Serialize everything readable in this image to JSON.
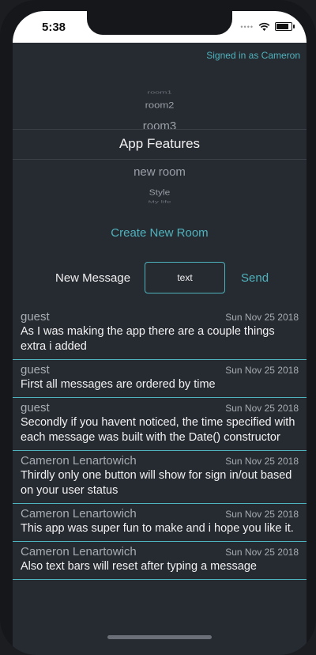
{
  "status_bar": {
    "time": "5:38",
    "wifi_icon": "wifi-icon",
    "battery_icon": "battery-icon"
  },
  "header": {
    "signed_in_text": "Signed in as Cameron"
  },
  "picker": {
    "rows": [
      "room1",
      "room2",
      "room3",
      "App Features",
      "new room",
      "Style",
      "My life"
    ],
    "selected": "App Features"
  },
  "create_room_label": "Create New Room",
  "composer": {
    "label": "New Message",
    "input_value": "text",
    "send_label": "Send"
  },
  "messages": [
    {
      "user": "guest",
      "date": "Sun Nov 25 2018",
      "text": "As I was making the app there are a couple things extra i added"
    },
    {
      "user": "guest",
      "date": "Sun Nov 25 2018",
      "text": "First all messages are ordered by time"
    },
    {
      "user": "guest",
      "date": "Sun Nov 25 2018",
      "text": "Secondly if you havent noticed, the time specified with each message was built with the Date() constructor"
    },
    {
      "user": "Cameron Lenartowich",
      "date": "Sun Nov 25 2018",
      "text": "Thirdly only one button will show for sign in/out based on your user status"
    },
    {
      "user": "Cameron Lenartowich",
      "date": "Sun Nov 25 2018",
      "text": "This app was super fun to make and i hope you like it."
    },
    {
      "user": "Cameron Lenartowich",
      "date": "Sun Nov 25 2018",
      "text": "Also text bars will reset after typing a message"
    }
  ],
  "colors": {
    "background": "#262a31",
    "accent": "#4fb3bd",
    "text": "#f2f2f2",
    "muted": "#a7acb3"
  }
}
